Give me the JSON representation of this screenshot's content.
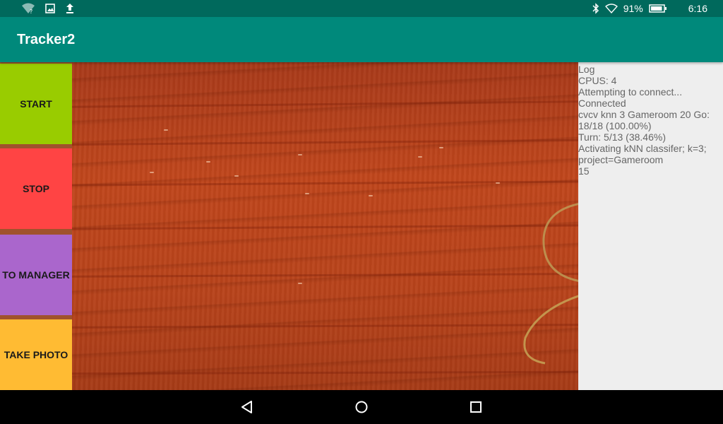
{
  "status_bar": {
    "left_icons": [
      "wifi-question-icon",
      "image-icon",
      "upload-icon"
    ],
    "right_icons": [
      "bluetooth-icon",
      "wifi-icon",
      "battery-icon"
    ],
    "battery_percent": "91%",
    "battery_level": 0.91,
    "time": "6:16"
  },
  "app_bar": {
    "title": "Tracker2"
  },
  "buttons": [
    {
      "label": "START",
      "color": "#99cc00"
    },
    {
      "label": "STOP",
      "color": "#ff4444"
    },
    {
      "label": "TO MANAGER",
      "color": "#aa66cc"
    },
    {
      "label": "TAKE PHOTO",
      "color": "#ffbb33"
    }
  ],
  "log": {
    "lines": [
      "Log",
      "CPUS: 4",
      "Attempting to connect...",
      "Connected",
      "cvcv knn 3 Gameroom 20 Go:",
      "18/18 (100.00%)",
      "Turn: 5/13 (38.46%)",
      "Activating kNN classifer; k=3;",
      "project=Gameroom",
      "15"
    ]
  },
  "nav_bar": {
    "icons": [
      "back-icon",
      "home-icon",
      "recents-icon"
    ]
  },
  "colors": {
    "status_bar": "#00695c",
    "app_bar": "#00897b",
    "log_background": "#eeeeee",
    "log_text": "#666666"
  }
}
